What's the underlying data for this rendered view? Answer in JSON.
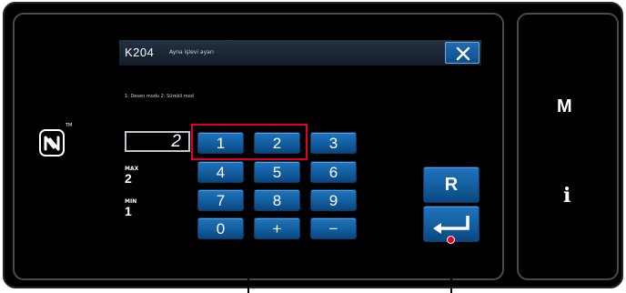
{
  "dialog": {
    "code": "K204",
    "title": "Ayna işlevi ayarı",
    "close_icon": "close-icon",
    "mode_description": "1: Desen modu 2: Sürekli mod"
  },
  "value_field": {
    "value": "2"
  },
  "limits": {
    "max_label": "MAX",
    "max_value": "2",
    "min_label": "MIN",
    "min_value": "1"
  },
  "keypad": {
    "keys": [
      "1",
      "2",
      "3",
      "4",
      "5",
      "6",
      "7",
      "8",
      "9",
      "0",
      "+",
      "−"
    ]
  },
  "reset_button": {
    "label": "R"
  },
  "enter_button": {
    "icon": "enter-icon"
  },
  "side_panel": {
    "mode_label": "M",
    "info_label": "i"
  },
  "nfc_icon": {
    "icon": "nfc-icon",
    "trademark": "TM"
  },
  "colors": {
    "key_blue": "#135e9f",
    "titlebar": "#1c2736",
    "highlight_red": "#e2002a",
    "background": "#000000"
  }
}
